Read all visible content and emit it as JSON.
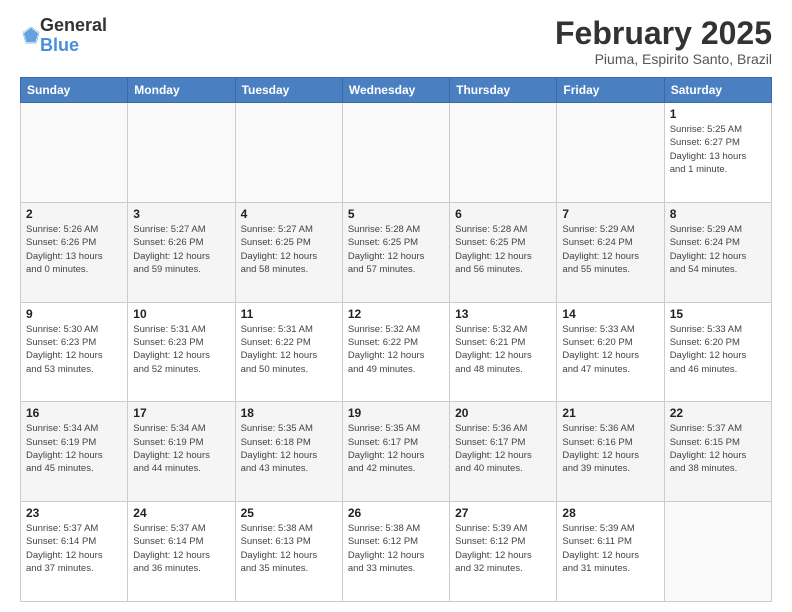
{
  "logo": {
    "general": "General",
    "blue": "Blue"
  },
  "header": {
    "month": "February 2025",
    "location": "Piuma, Espirito Santo, Brazil"
  },
  "weekdays": [
    "Sunday",
    "Monday",
    "Tuesday",
    "Wednesday",
    "Thursday",
    "Friday",
    "Saturday"
  ],
  "weeks": [
    [
      {
        "day": "",
        "info": ""
      },
      {
        "day": "",
        "info": ""
      },
      {
        "day": "",
        "info": ""
      },
      {
        "day": "",
        "info": ""
      },
      {
        "day": "",
        "info": ""
      },
      {
        "day": "",
        "info": ""
      },
      {
        "day": "1",
        "info": "Sunrise: 5:25 AM\nSunset: 6:27 PM\nDaylight: 13 hours\nand 1 minute."
      }
    ],
    [
      {
        "day": "2",
        "info": "Sunrise: 5:26 AM\nSunset: 6:26 PM\nDaylight: 13 hours\nand 0 minutes."
      },
      {
        "day": "3",
        "info": "Sunrise: 5:27 AM\nSunset: 6:26 PM\nDaylight: 12 hours\nand 59 minutes."
      },
      {
        "day": "4",
        "info": "Sunrise: 5:27 AM\nSunset: 6:25 PM\nDaylight: 12 hours\nand 58 minutes."
      },
      {
        "day": "5",
        "info": "Sunrise: 5:28 AM\nSunset: 6:25 PM\nDaylight: 12 hours\nand 57 minutes."
      },
      {
        "day": "6",
        "info": "Sunrise: 5:28 AM\nSunset: 6:25 PM\nDaylight: 12 hours\nand 56 minutes."
      },
      {
        "day": "7",
        "info": "Sunrise: 5:29 AM\nSunset: 6:24 PM\nDaylight: 12 hours\nand 55 minutes."
      },
      {
        "day": "8",
        "info": "Sunrise: 5:29 AM\nSunset: 6:24 PM\nDaylight: 12 hours\nand 54 minutes."
      }
    ],
    [
      {
        "day": "9",
        "info": "Sunrise: 5:30 AM\nSunset: 6:23 PM\nDaylight: 12 hours\nand 53 minutes."
      },
      {
        "day": "10",
        "info": "Sunrise: 5:31 AM\nSunset: 6:23 PM\nDaylight: 12 hours\nand 52 minutes."
      },
      {
        "day": "11",
        "info": "Sunrise: 5:31 AM\nSunset: 6:22 PM\nDaylight: 12 hours\nand 50 minutes."
      },
      {
        "day": "12",
        "info": "Sunrise: 5:32 AM\nSunset: 6:22 PM\nDaylight: 12 hours\nand 49 minutes."
      },
      {
        "day": "13",
        "info": "Sunrise: 5:32 AM\nSunset: 6:21 PM\nDaylight: 12 hours\nand 48 minutes."
      },
      {
        "day": "14",
        "info": "Sunrise: 5:33 AM\nSunset: 6:20 PM\nDaylight: 12 hours\nand 47 minutes."
      },
      {
        "day": "15",
        "info": "Sunrise: 5:33 AM\nSunset: 6:20 PM\nDaylight: 12 hours\nand 46 minutes."
      }
    ],
    [
      {
        "day": "16",
        "info": "Sunrise: 5:34 AM\nSunset: 6:19 PM\nDaylight: 12 hours\nand 45 minutes."
      },
      {
        "day": "17",
        "info": "Sunrise: 5:34 AM\nSunset: 6:19 PM\nDaylight: 12 hours\nand 44 minutes."
      },
      {
        "day": "18",
        "info": "Sunrise: 5:35 AM\nSunset: 6:18 PM\nDaylight: 12 hours\nand 43 minutes."
      },
      {
        "day": "19",
        "info": "Sunrise: 5:35 AM\nSunset: 6:17 PM\nDaylight: 12 hours\nand 42 minutes."
      },
      {
        "day": "20",
        "info": "Sunrise: 5:36 AM\nSunset: 6:17 PM\nDaylight: 12 hours\nand 40 minutes."
      },
      {
        "day": "21",
        "info": "Sunrise: 5:36 AM\nSunset: 6:16 PM\nDaylight: 12 hours\nand 39 minutes."
      },
      {
        "day": "22",
        "info": "Sunrise: 5:37 AM\nSunset: 6:15 PM\nDaylight: 12 hours\nand 38 minutes."
      }
    ],
    [
      {
        "day": "23",
        "info": "Sunrise: 5:37 AM\nSunset: 6:14 PM\nDaylight: 12 hours\nand 37 minutes."
      },
      {
        "day": "24",
        "info": "Sunrise: 5:37 AM\nSunset: 6:14 PM\nDaylight: 12 hours\nand 36 minutes."
      },
      {
        "day": "25",
        "info": "Sunrise: 5:38 AM\nSunset: 6:13 PM\nDaylight: 12 hours\nand 35 minutes."
      },
      {
        "day": "26",
        "info": "Sunrise: 5:38 AM\nSunset: 6:12 PM\nDaylight: 12 hours\nand 33 minutes."
      },
      {
        "day": "27",
        "info": "Sunrise: 5:39 AM\nSunset: 6:12 PM\nDaylight: 12 hours\nand 32 minutes."
      },
      {
        "day": "28",
        "info": "Sunrise: 5:39 AM\nSunset: 6:11 PM\nDaylight: 12 hours\nand 31 minutes."
      },
      {
        "day": "",
        "info": ""
      }
    ]
  ]
}
